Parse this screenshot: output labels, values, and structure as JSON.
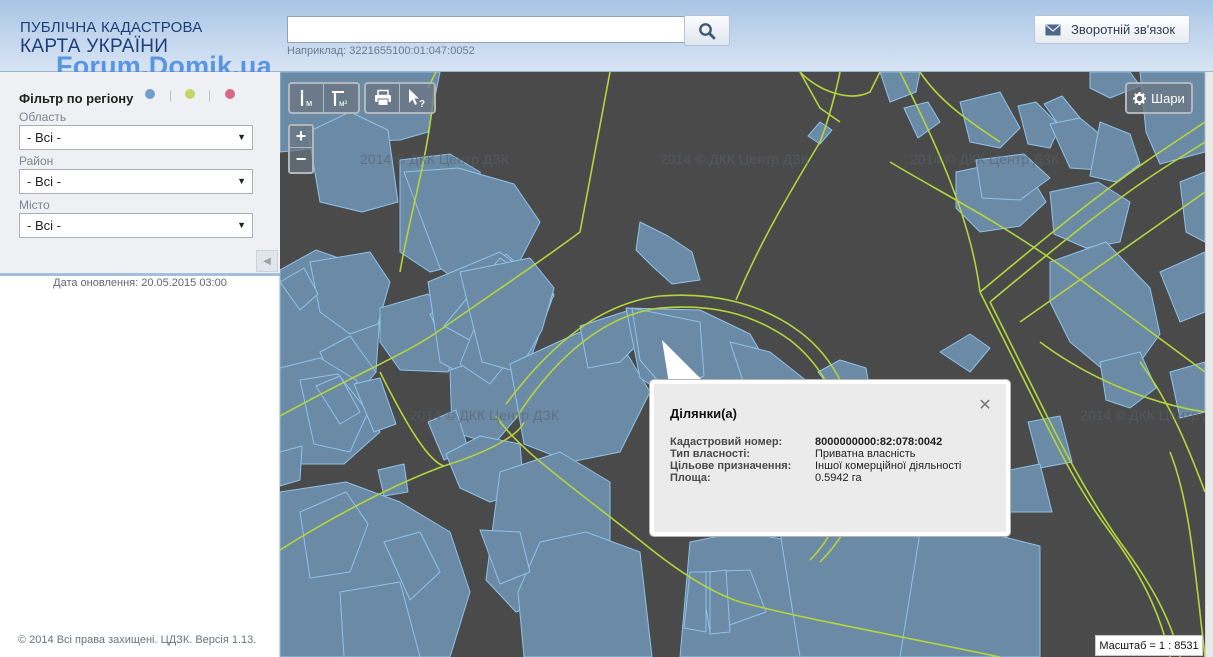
{
  "header": {
    "title_line1": "ПУБЛІЧНА КАДАСТРОВА",
    "title_line2": "КАРТА УКРАЇНИ",
    "watermark": "Forum.Domik.ua",
    "search": {
      "value": "",
      "placeholder": "",
      "hint": "Наприклад: 3221655100:01:047:0052"
    },
    "feedback_label": "Зворотній зв'язок"
  },
  "sidebar": {
    "filter_title": "Фільтр по регіону",
    "status_colors": [
      "#6f9fcc",
      "#c8d46a",
      "#d66a86"
    ],
    "fields": [
      {
        "label": "Область",
        "selected": "- Всі -"
      },
      {
        "label": "Район",
        "selected": "- Всі -"
      },
      {
        "label": "Місто",
        "selected": "- Всі -"
      }
    ],
    "update_date": "Дата оновлення: 20.05.2015 03:00",
    "copyright": "© 2014 Всі права захищені. ЦДЗК. Версія 1.13."
  },
  "map": {
    "tile_watermark": "2014 © ДКК  Центр ДЗК",
    "tools": {
      "measure_length_label": "м",
      "measure_area_label": "м²",
      "print_icon": "printer-icon",
      "identify_icon": "pointer-question-icon"
    },
    "zoom_in_label": "+",
    "zoom_out_label": "−",
    "layers_label": "Шари",
    "scale": "Масштаб = 1 : 8531",
    "colors": {
      "background": "#4a4a4a",
      "parcel_fill": "#6b8aa6",
      "parcel_stroke": "#8ec3ea",
      "boundary": "#b6d43c"
    }
  },
  "popup": {
    "title": "Ділянки(а)",
    "rows": [
      {
        "key": "Кадастровий номер:",
        "value": "8000000000:82:078:0042",
        "bold": true
      },
      {
        "key": "Тип власності:",
        "value": "Приватна власність",
        "bold": false
      },
      {
        "key": "Цільове призначення:",
        "value": "Іншої комерційної діяльності",
        "bold": false
      },
      {
        "key": "Площа:",
        "value": "0.5942 га",
        "bold": false
      }
    ]
  }
}
